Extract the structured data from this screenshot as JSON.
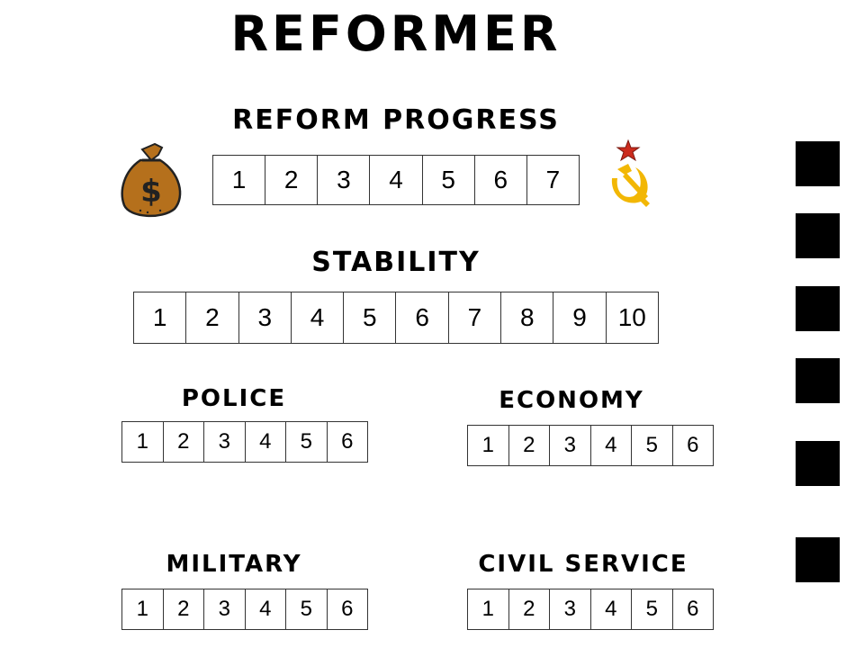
{
  "title": "REFORMER",
  "reform_progress": {
    "label": "Reform Progress",
    "cells": [
      "1",
      "2",
      "3",
      "4",
      "5",
      "6",
      "7"
    ],
    "left_icon": "money-bag-icon",
    "right_icon": "hammer-sickle-icon"
  },
  "stability": {
    "label": "Stability",
    "cells": [
      "1",
      "2",
      "3",
      "4",
      "5",
      "6",
      "7",
      "8",
      "9",
      "10"
    ]
  },
  "police": {
    "label": "Police",
    "cells": [
      "1",
      "2",
      "3",
      "4",
      "5",
      "6"
    ]
  },
  "economy": {
    "label": "Economy",
    "cells": [
      "1",
      "2",
      "3",
      "4",
      "5",
      "6"
    ]
  },
  "military": {
    "label": "Military",
    "cells": [
      "1",
      "2",
      "3",
      "4",
      "5",
      "6"
    ]
  },
  "civil_service": {
    "label": "Civil Service",
    "cells": [
      "1",
      "2",
      "3",
      "4",
      "5",
      "6"
    ]
  },
  "side_squares": 6,
  "colors": {
    "bag": "#b5701c",
    "soviet": "#f2b705",
    "star": "#cc2b1d",
    "square": "#000000"
  }
}
